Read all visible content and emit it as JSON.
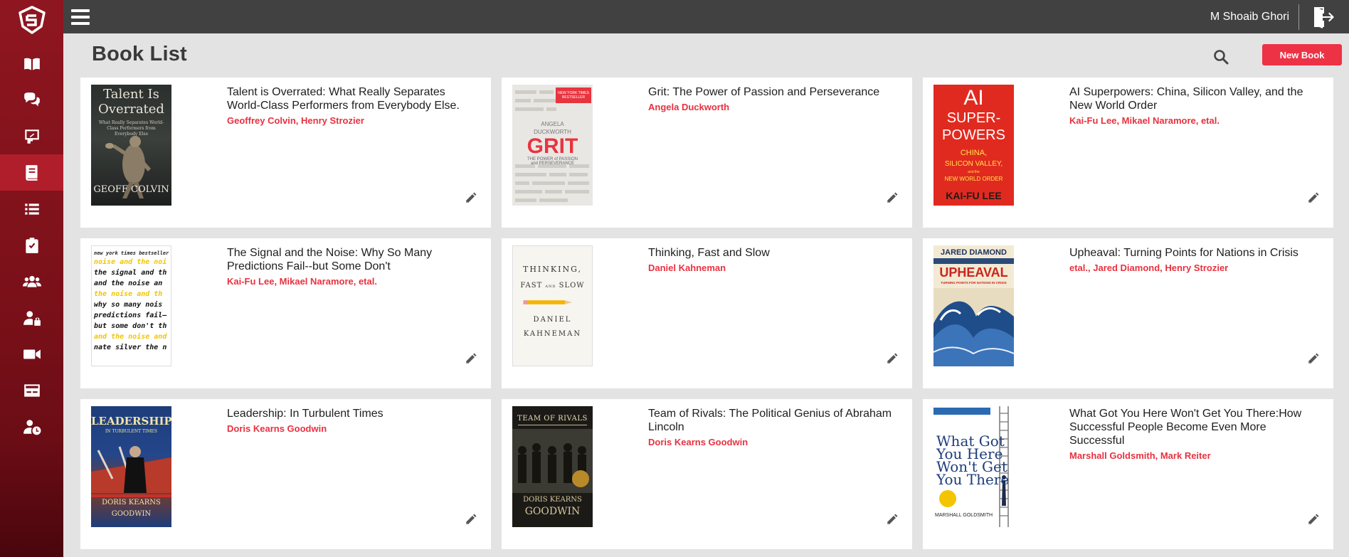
{
  "header": {
    "user_name": "M Shoaib Ghori"
  },
  "page": {
    "title": "Book List",
    "new_book_label": "New Book"
  },
  "sidebar": {
    "items": [
      {
        "icon": "book-open-icon"
      },
      {
        "icon": "chat-icon"
      },
      {
        "icon": "presentation-icon"
      },
      {
        "icon": "book-icon",
        "active": true
      },
      {
        "icon": "list-icon"
      },
      {
        "icon": "clipboard-check-icon"
      },
      {
        "icon": "users-icon"
      },
      {
        "icon": "user-lock-icon"
      },
      {
        "icon": "video-icon"
      },
      {
        "icon": "card-icon"
      },
      {
        "icon": "user-clock-icon"
      }
    ]
  },
  "books": [
    {
      "title": "Talent is Overrated: What Really Separates World-Class Performers from Everybody Else.",
      "authors": "Geoffrey Colvin, Henry Strozier",
      "cover": {
        "line1": "Talent Is",
        "line2": "Overrated",
        "sub": "What Really Separates World-Class Performers from Everybody Else",
        "author": "GEOFF COLVIN"
      }
    },
    {
      "title": "Grit: The Power of Passion and Perseverance",
      "authors": "Angela Duckworth",
      "cover": {
        "badge": "NEW YORK TIMES BESTSELLER",
        "author": "ANGELA DUCKWORTH",
        "word": "GRIT",
        "sub": "THE POWER of PASSION and PERSEVERANCE"
      }
    },
    {
      "title": "AI Superpowers: China, Silicon Valley, and the New World Order",
      "authors": "Kai-Fu Lee, Mikael Naramore, etal.",
      "cover": {
        "l1": "AI",
        "l2": "SUPER-",
        "l3": "POWERS",
        "l4": "CHINA,",
        "l5": "SILICON VALLEY,",
        "l6": "and the",
        "l7": "NEW WORLD ORDER",
        "author": "KAI-FU LEE"
      }
    },
    {
      "title": "The Signal and the Noise: Why So Many Predictions Fail--but Some Don't",
      "authors": "Kai-Fu Lee, Mikael Naramore, etal.",
      "cover": {
        "top": "new york times bestseller",
        "lines": [
          "noise and the noi",
          "the signal and th",
          "and the noise an",
          "the noise and th",
          "why so many nois",
          "predictions fail—",
          "but some don't th",
          "and the noise and",
          "nate silver the n"
        ]
      }
    },
    {
      "title": "Thinking, Fast and Slow",
      "authors": "Daniel Kahneman",
      "cover": {
        "l1": "THINKING,",
        "l2": "FAST",
        "l3": "AND",
        "l4": "SLOW",
        "a1": "DANIEL",
        "a2": "KAHNEMAN"
      }
    },
    {
      "title": "Upheaval: Turning Points for Nations in Crisis",
      "authors": "etal., Jared Diamond, Henry Strozier",
      "cover": {
        "author": "JARED DIAMOND",
        "word": "UPHEAVAL",
        "sub": "TURNING POINTS FOR NATIONS IN CRISIS"
      }
    },
    {
      "title": "Leadership: In Turbulent Times",
      "authors": "Doris Kearns Goodwin",
      "cover": {
        "word": "LEADERSHIP",
        "sub": "IN TURBULENT TIMES",
        "a1": "DORIS KEARNS",
        "a2": "GOODWIN"
      }
    },
    {
      "title": "Team of Rivals: The Political Genius of Abraham Lincoln",
      "authors": "Doris Kearns Goodwin",
      "cover": {
        "word": "TEAM OF RIVALS",
        "a1": "DORIS KEARNS",
        "a2": "GOODWIN"
      }
    },
    {
      "title": "What Got You Here Won't Get You There:How Successful People Become Even More Successful",
      "authors": "Marshall Goldsmith, Mark Reiter",
      "cover": {
        "l1": "What Got",
        "l2": "You Here",
        "l3": "Won't Get",
        "l4": "You There",
        "author": "MARSHALL GOLDSMITH"
      }
    }
  ],
  "colors": {
    "accent": "#ee3245",
    "author_text": "#e8313f",
    "sidebar": "#8f1620",
    "topbar": "#414141",
    "page_bg": "#e3e3e3"
  }
}
